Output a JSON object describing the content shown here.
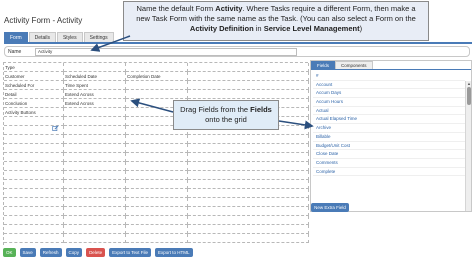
{
  "window": {
    "title": "Activity Form - Activity"
  },
  "tabs": [
    "Form",
    "Details",
    "Styles",
    "Settings"
  ],
  "name_field": {
    "label": "Name",
    "value": "Activity"
  },
  "grid": {
    "rows": [
      [
        "Type",
        "",
        "",
        ""
      ],
      [
        "Customer",
        "Scheduled Date",
        "Completion Date",
        ""
      ],
      [
        "Scheduled For",
        "Time Spent",
        "",
        ""
      ],
      [
        "Detail",
        "Extend Across",
        "",
        ""
      ],
      [
        "Conclusion",
        "Extend Across",
        "",
        ""
      ],
      [
        "Activity Buttons",
        "",
        "",
        ""
      ]
    ]
  },
  "fields_panel": {
    "tabs": [
      "Fields",
      "Components"
    ],
    "items": [
      "#",
      "Account",
      "Accum Days",
      "Accum Hours",
      "Actual",
      "Actual Elapsed Time",
      "Archive",
      "Billable",
      "Budget/Unit Cost",
      "Close Date",
      "Comments",
      "Complete"
    ],
    "new_extra_field_label": "New Extra Field"
  },
  "bottom_buttons": [
    {
      "label": "OK",
      "color": "#57b257"
    },
    {
      "label": "Save",
      "color": "#4a7bb7"
    },
    {
      "label": "Refresh",
      "color": "#4a7bb7"
    },
    {
      "label": "Copy",
      "color": "#4a7bb7"
    },
    {
      "label": "Delete",
      "color": "#d9534f"
    },
    {
      "label": "Export to Text File",
      "color": "#4a7bb7"
    },
    {
      "label": "Export to HTML",
      "color": "#4a7bb7"
    }
  ],
  "callouts": {
    "top": {
      "part1": "Name the default Form ",
      "bold1": "Activity",
      "part2": ". Where Tasks require a different Form, then make a new Task Form with the same name as the Task. (You can also select a Form on the ",
      "bold2": "Activity Definition",
      "part3": " in ",
      "bold3": "Service Level Management",
      "part4": ")"
    },
    "mid": {
      "part1": "Drag Fields from the ",
      "bold1": "Fields",
      "part2": " onto the grid"
    }
  },
  "colors": {
    "accent": "#4a7bb7",
    "ok": "#57b257",
    "delete": "#d9534f",
    "field_text": "#2c63a8"
  }
}
